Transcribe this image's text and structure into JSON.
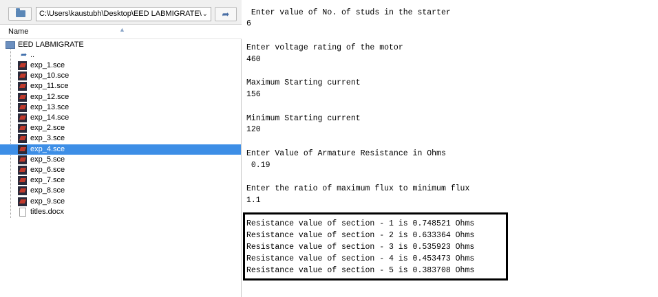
{
  "file_browser": {
    "path": "C:\\Users\\kaustubh\\Desktop\\EED LABMIGRATE\\",
    "column_header": "Name",
    "root_folder": "EED LABMIGRATE",
    "parent_entry": "..",
    "files": [
      "exp_1.sce",
      "exp_10.sce",
      "exp_11.sce",
      "exp_12.sce",
      "exp_13.sce",
      "exp_14.sce",
      "exp_2.sce",
      "exp_3.sce",
      "exp_4.sce",
      "exp_5.sce",
      "exp_6.sce",
      "exp_7.sce",
      "exp_8.sce",
      "exp_9.sce",
      "titles.docx"
    ],
    "selected_file": "exp_4.sce"
  },
  "console": {
    "lines": [
      " Enter value of No. of studs in the starter",
      "6",
      "Enter voltage rating of the motor",
      "460",
      "Maximum Starting current",
      "156",
      "Minimum Starting current",
      "120",
      "Enter Value of Armature Resistance in Ohms",
      " 0.19",
      "Enter the ratio of maximum flux to minimum flux",
      "1.1"
    ],
    "results": [
      "Resistance value of section - 1 is 0.748521 Ohms",
      "Resistance value of section - 2 is 0.633364 Ohms",
      "Resistance value of section - 3 is 0.535923 Ohms",
      "Resistance value of section - 4 is 0.453473 Ohms",
      "Resistance value of section - 5 is 0.383708 Ohms"
    ]
  }
}
